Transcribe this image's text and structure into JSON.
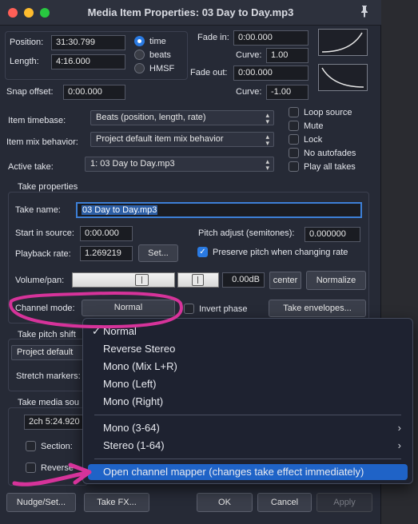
{
  "window": {
    "title": "Media Item Properties:  03 Day to Day.mp3",
    "pin_icon": "pin-icon"
  },
  "position": {
    "position_label": "Position:",
    "position_value": "31:30.799",
    "length_label": "Length:",
    "length_value": "4:16.000"
  },
  "timebase_radio": {
    "time": "time",
    "beats": "beats",
    "hmsf": "HMSF",
    "selected": "time"
  },
  "fade": {
    "fade_in_label": "Fade in:",
    "fade_in_value": "0:00.000",
    "curve_label": "Curve:",
    "fade_in_curve": "1.00",
    "fade_out_label": "Fade out:",
    "fade_out_value": "0:00.000",
    "fade_out_curve": "-1.00"
  },
  "snap": {
    "label": "Snap offset:",
    "value": "0:00.000"
  },
  "item": {
    "timebase_label": "Item timebase:",
    "timebase_value": "Beats (position, length, rate)",
    "mix_label": "Item mix behavior:",
    "mix_value": "Project default item mix behavior",
    "active_take_label": "Active take:",
    "active_take_value": "1: 03 Day to Day.mp3"
  },
  "options": {
    "loop_source": "Loop source",
    "mute": "Mute",
    "lock": "Lock",
    "no_autofades": "No autofades",
    "play_all_takes": "Play all takes"
  },
  "take": {
    "section_label": "Take properties",
    "name_label": "Take name:",
    "name_value": "03 Day to Day.mp3",
    "start_label": "Start in source:",
    "start_value": "0:00.000",
    "pitch_label": "Pitch adjust (semitones):",
    "pitch_value": "0.000000",
    "rate_label": "Playback rate:",
    "rate_value": "1.269219",
    "set_button": "Set...",
    "preserve_pitch": "Preserve pitch when changing rate",
    "volpan_label": "Volume/pan:",
    "db_value": "0.00dB",
    "pan_value": "center",
    "normalize_button": "Normalize",
    "channel_mode_label": "Channel mode:",
    "channel_mode_value": "Normal",
    "invert_phase": "Invert phase",
    "take_envelopes_button": "Take envelopes..."
  },
  "pitch_shift": {
    "section_label": "Take pitch shift",
    "mode_value": "Project default",
    "stretch_label": "Stretch markers:"
  },
  "media_source": {
    "section_label": "Take media sou",
    "source_value": "2ch 5:24.920 :",
    "section_chk": "Section:",
    "reverse_chk": "Reverse"
  },
  "bottom_buttons": {
    "nudge": "Nudge/Set...",
    "take_fx": "Take FX...",
    "ok": "OK",
    "cancel": "Cancel",
    "apply": "Apply"
  },
  "channel_menu": {
    "items": [
      {
        "label": "Normal",
        "checked": "✓"
      },
      {
        "label": "Reverse Stereo"
      },
      {
        "label": "Mono (Mix L+R)"
      },
      {
        "label": "Mono (Left)"
      },
      {
        "label": "Mono (Right)"
      },
      {
        "label": "Mono (3-64)",
        "submenu": "›"
      },
      {
        "label": "Stereo (1-64)",
        "submenu": "›"
      },
      {
        "label": "Open channel mapper (changes take effect immediately)"
      }
    ],
    "selected_index": 7
  },
  "annotation": {
    "color": "#d6339a"
  }
}
